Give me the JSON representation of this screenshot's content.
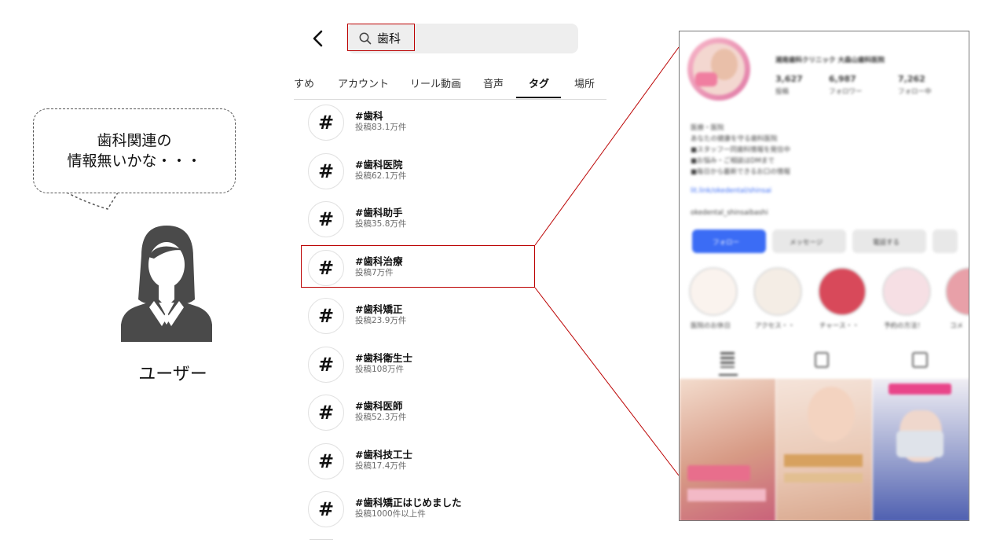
{
  "bubble": {
    "line1": "歯科関連の",
    "line2": "情報無いかな・・・"
  },
  "user": {
    "label": "ユーザー"
  },
  "search": {
    "query": "歯科"
  },
  "tabs": [
    {
      "label": "すめ"
    },
    {
      "label": "アカウント"
    },
    {
      "label": "リール動画"
    },
    {
      "label": "音声"
    },
    {
      "label": "タグ",
      "active": true
    },
    {
      "label": "場所"
    }
  ],
  "tags": [
    {
      "name": "#歯科",
      "count": "投稿83.1万件"
    },
    {
      "name": "#歯科医院",
      "count": "投稿62.1万件"
    },
    {
      "name": "#歯科助手",
      "count": "投稿35.8万件"
    },
    {
      "name": "#歯科治療",
      "count": "投稿7万件",
      "highlighted": true
    },
    {
      "name": "#歯科矯正",
      "count": "投稿23.9万件"
    },
    {
      "name": "#歯科衛生士",
      "count": "投稿108万件"
    },
    {
      "name": "#歯科医師",
      "count": "投稿52.3万件"
    },
    {
      "name": "#歯科技工士",
      "count": "投稿17.4万件"
    },
    {
      "name": "#歯科矯正はじめました",
      "count": "投稿1000件以上件"
    }
  ],
  "hash_symbol": "#",
  "profile": {
    "name": "湘南歯科クリニック 大森山歯科医院",
    "stats": [
      {
        "value": "3,627",
        "label": "投稿"
      },
      {
        "value": "6,987",
        "label": "フォロワー"
      },
      {
        "value": "7,262",
        "label": "フォロー中"
      }
    ],
    "bio": [
      "医療・医院",
      "あなたの健康を守る歯科医院",
      "■スタッフ一同歯科情報を発信中",
      "■お悩み・ご相談はDMまで",
      "■毎日から最新できるお口の情報"
    ],
    "link": "lit.link/okedental/shinsai",
    "threads": "okedental_shinsaibashi",
    "buttons": [
      "フォロー",
      "メッセージ",
      "電話する"
    ],
    "highlights": [
      "医院のお休日",
      "アクセス・・",
      "チャース・・",
      "予約の方法！",
      "コメ"
    ],
    "accent": "#3b6cf5"
  }
}
